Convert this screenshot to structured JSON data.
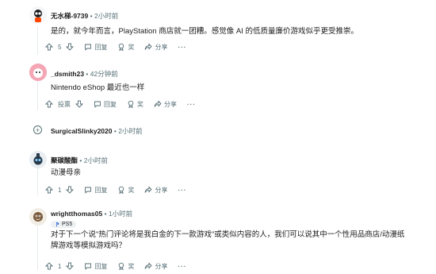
{
  "comments": [
    {
      "username": "无水梯-9739",
      "time": "2小时前",
      "text": "是的，就今年而言，PlayStation 商店就一团糟。感觉像 AI 的低质量廉价游戏似乎更受推崇。",
      "votes": "5",
      "reply_label": "回复",
      "award_label": "奖",
      "share_label": "分享",
      "more_label": "···"
    },
    {
      "username": "_dsmith23",
      "time": "42分钟前",
      "text": "Nintendo eShop 最近也一样",
      "votes": "投票",
      "reply_label": "回复",
      "award_label": "奖",
      "share_label": "分享",
      "more_label": "···"
    },
    {
      "username": "SurgicalSlinky2020",
      "time": "2小时前",
      "collapsed_label": "+"
    },
    {
      "username": "聚碳酸酯",
      "time": "2小时前",
      "text": "动漫母亲",
      "votes": "1",
      "reply_label": "回复",
      "award_label": "奖",
      "share_label": "分享",
      "more_label": "···"
    },
    {
      "username": "wrightthomas05",
      "time": "1小时前",
      "flair": "PS5",
      "text": "对于下一个说\"热门评论将是我白金的下一款游戏\"或类似内容的人，我们可以说其中一个性用品商店/动漫纸牌游戏等模拟游戏吗？",
      "votes": "1",
      "reply_label": "回复",
      "award_label": "奖",
      "share_label": "分享",
      "more_label": "···"
    }
  ],
  "separator": "•",
  "colors": {
    "meta": "#576f76",
    "text": "#1c1c1c",
    "flair_bg": "#eef1f3",
    "thread_line": "#e5ebee"
  }
}
